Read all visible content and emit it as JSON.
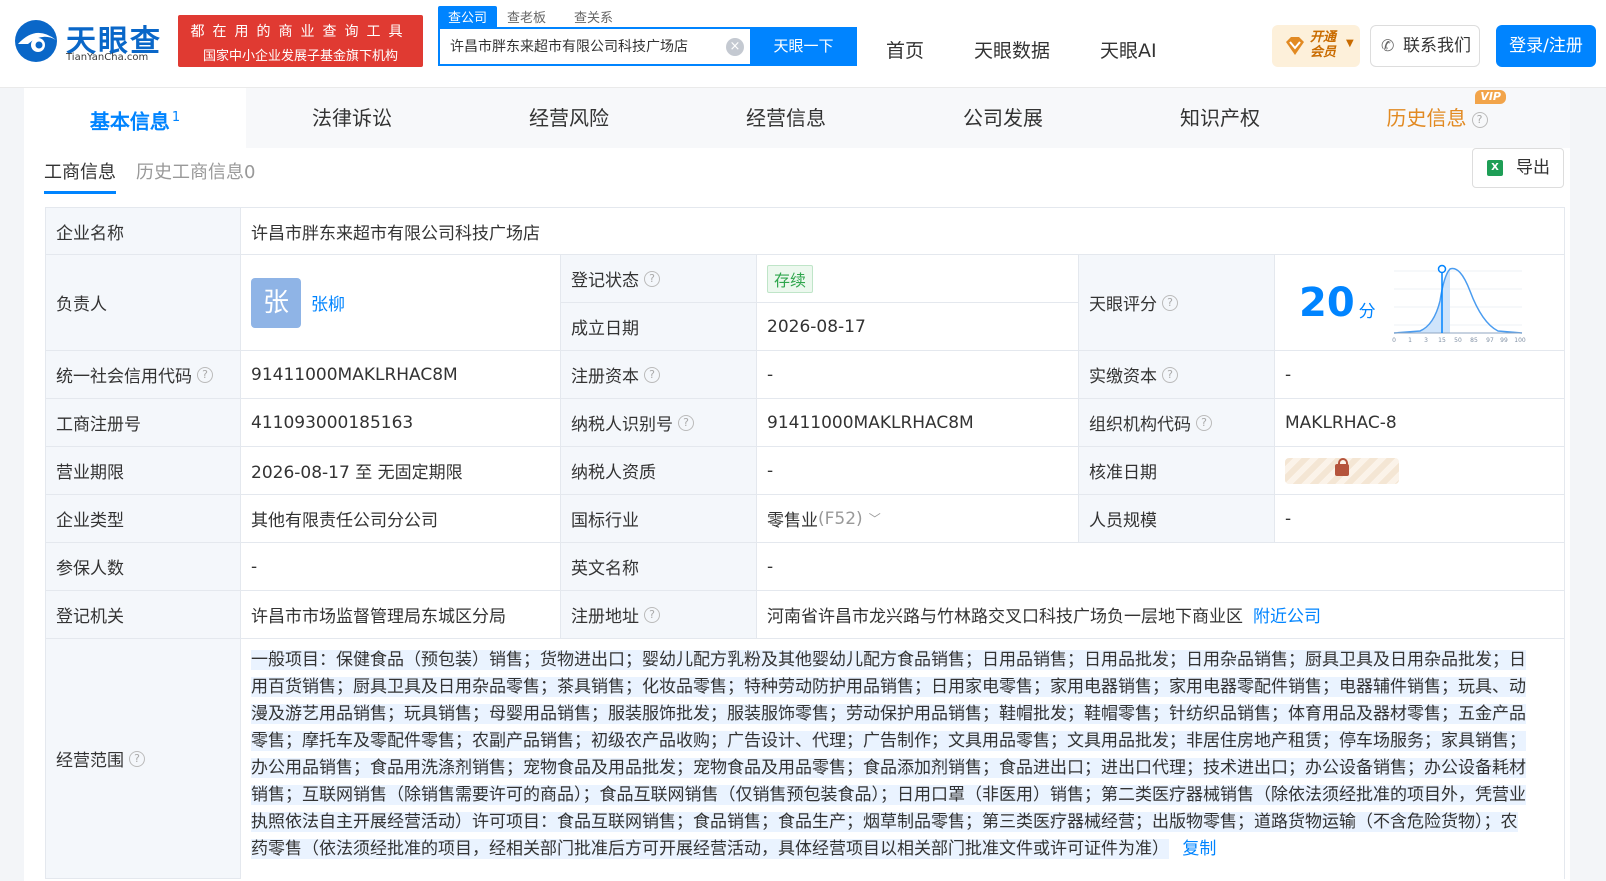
{
  "header": {
    "logo_text": "天眼查",
    "logo_sub": "TianYanCha.com",
    "promo_line1": "都在用的商业查询工具",
    "promo_line2": "国家中小企业发展子基金旗下机构",
    "search_tabs": [
      "查公司",
      "查老板",
      "查关系"
    ],
    "search_value": "许昌市胖东来超市有限公司科技广场店",
    "search_button": "天眼一下",
    "nav": [
      "首页",
      "天眼数据",
      "天眼AI"
    ],
    "vip_label_1": "开通",
    "vip_label_2": "会员",
    "contact_label": "联系我们",
    "login_label": "登录/注册"
  },
  "main_tabs": {
    "items": [
      "基本信息",
      "法律诉讼",
      "经营风险",
      "经营信息",
      "公司发展",
      "知识产权",
      "历史信息"
    ],
    "basic_count": "1",
    "vip_tag": "VIP"
  },
  "sub_tabs": [
    "工商信息",
    "历史工商信息0"
  ],
  "export_label": "导出",
  "info": {
    "company_name_label": "企业名称",
    "company_name": "许昌市胖东来超市有限公司科技广场店",
    "legal_label": "负责人",
    "legal_avatar": "张",
    "legal_name": "张柳",
    "reg_status_label": "登记状态",
    "reg_status": "存续",
    "est_date_label": "成立日期",
    "est_date": "2026-08-17",
    "score_label": "天眼评分",
    "score": "20",
    "score_unit": "分",
    "score_ticks": [
      "0",
      "1",
      "3",
      "15",
      "50",
      "85",
      "97",
      "99",
      "100"
    ],
    "credit_code_label": "统一社会信用代码",
    "credit_code": "91411000MAKLRHAC8M",
    "reg_capital_label": "注册资本",
    "reg_capital": "-",
    "paid_capital_label": "实缴资本",
    "paid_capital": "-",
    "reg_no_label": "工商注册号",
    "reg_no": "411093000185163",
    "tax_id_label": "纳税人识别号",
    "tax_id": "91411000MAKLRHAC8M",
    "org_code_label": "组织机构代码",
    "org_code": "MAKLRHAC-8",
    "term_label": "营业期限",
    "term": "2026-08-17 至 无固定期限",
    "taxpayer_label": "纳税人资质",
    "taxpayer": "-",
    "approve_date_label": "核准日期",
    "type_label": "企业类型",
    "type": "其他有限责任公司分公司",
    "industry_label": "国标行业",
    "industry": "零售业",
    "industry_code": "(F52)",
    "staff_label": "人员规模",
    "staff": "-",
    "insured_label": "参保人数",
    "insured": "-",
    "en_name_label": "英文名称",
    "en_name": "-",
    "authority_label": "登记机关",
    "authority": "许昌市市场监督管理局东城区分局",
    "address_label": "注册地址",
    "address": "河南省许昌市龙兴路与竹林路交叉口科技广场负一层地下商业区",
    "nearby_label": "附近公司",
    "scope_label": "经营范围",
    "scope": "一般项目：保健食品（预包装）销售；货物进出口；婴幼儿配方乳粉及其他婴幼儿配方食品销售；日用品销售；日用品批发；日用杂品销售；厨具卫具及日用杂品批发；日用百货销售；厨具卫具及日用杂品零售；茶具销售；化妆品零售；特种劳动防护用品销售；日用家电零售；家用电器销售；家用电器零配件销售；电器辅件销售；玩具、动漫及游艺用品销售；玩具销售；母婴用品销售；服装服饰批发；服装服饰零售；劳动保护用品销售；鞋帽批发；鞋帽零售；针纺织品销售；体育用品及器材零售；五金产品零售；摩托车及零配件零售；农副产品销售；初级农产品收购；广告设计、代理；广告制作；文具用品零售；文具用品批发；非居住房地产租赁；停车场服务；家具销售；办公用品销售；食品用洗涤剂销售；宠物食品及用品批发；宠物食品及用品零售；食品添加剂销售；食品进出口；进出口代理；技术进出口；办公设备销售；办公设备耗材销售；互联网销售（除销售需要许可的商品）；食品互联网销售（仅销售预包装食品）；日用口罩（非医用）销售；第二类医疗器械销售（除依法须经批准的项目外，凭营业执照依法自主开展经营活动）许可项目：食品互联网销售；食品销售；食品生产；烟草制品零售；第三类医疗器械经营；出版物零售；道路货物运输（不含危险货物）；农药零售（依法须经批准的项目，经相关部门批准后方可开展经营活动，具体经营项目以相关部门批准文件或许可证件为准）",
    "copy_label": "复制"
  },
  "colors": {
    "brand_blue": "#0084ff",
    "promo_red": "#e03a32",
    "status_green": "#2fa64d",
    "history_orange": "#e28a22"
  }
}
